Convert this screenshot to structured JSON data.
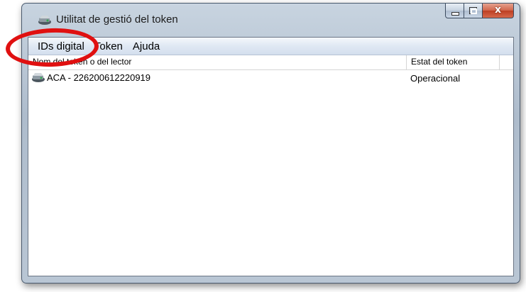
{
  "window": {
    "title": "Utilitat de gestió del token"
  },
  "caption": {
    "close_label": "x"
  },
  "menubar": {
    "items": [
      "IDs digital",
      "Token",
      "Ajuda"
    ]
  },
  "table": {
    "columns": [
      "Nom del token o del lector",
      "Estat del token"
    ],
    "rows": [
      {
        "name": "ACA - 226200612220919",
        "status": "Operacional",
        "icon": "token-reader-icon"
      }
    ]
  },
  "annotation": {
    "highlight_color": "#e01010",
    "highlight_target": "IDs digital"
  }
}
